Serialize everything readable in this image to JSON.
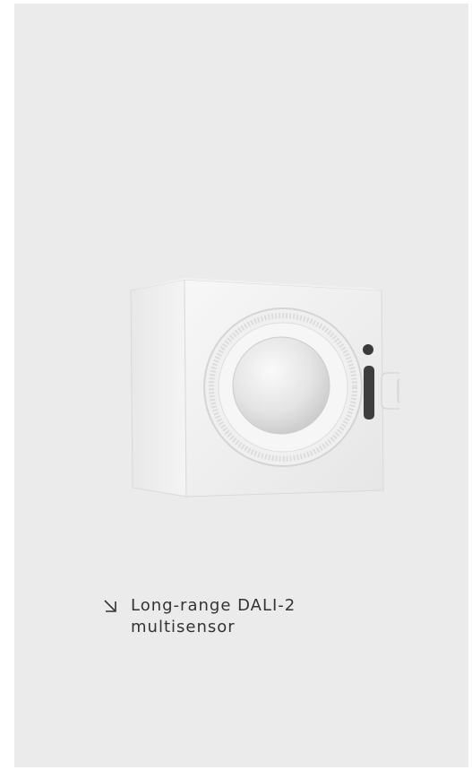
{
  "card": {
    "background": "#ebebeb"
  },
  "product": {
    "image_icon": "multisensor-device-image"
  },
  "caption": {
    "icon": "arrow-down-right-icon",
    "line1": "Long-range DALI-2",
    "line2": "multisensor"
  },
  "colors": {
    "text": "#333333",
    "card_bg": "#ebebeb"
  }
}
